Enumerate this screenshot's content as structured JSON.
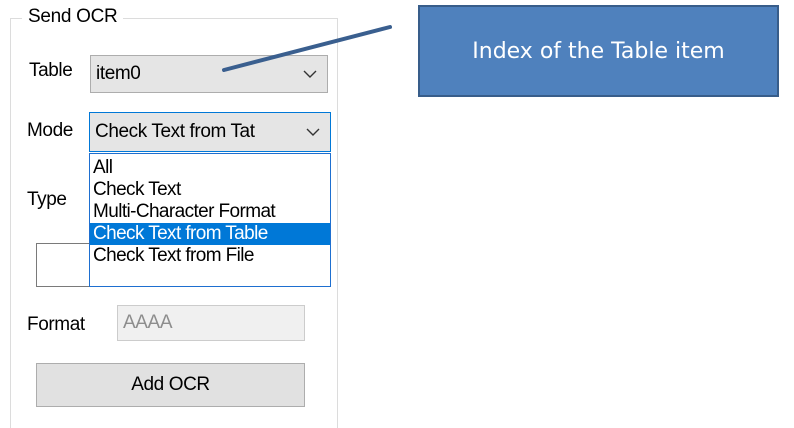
{
  "group": {
    "title": "Send OCR"
  },
  "table": {
    "label": "Table",
    "value": "item0",
    "dropdown_icon": "chevron-down-icon"
  },
  "mode": {
    "label": "Mode",
    "value": "Check Text from Tat",
    "dropdown_icon": "chevron-down-icon",
    "options": [
      "All",
      "Check Text",
      "Multi-Character Format",
      "Check Text from Table",
      "Check Text from File"
    ],
    "selected_index": 3
  },
  "type": {
    "label": "Type"
  },
  "format": {
    "label": "Format",
    "value": "AAAA"
  },
  "add_button": {
    "label": "Add OCR"
  },
  "callout": {
    "text": "Index of the Table item"
  },
  "colors": {
    "accent": "#0078d7",
    "callout_fill": "#4f81bd",
    "callout_border": "#385d8a",
    "arrow": "#3a5f8f"
  }
}
